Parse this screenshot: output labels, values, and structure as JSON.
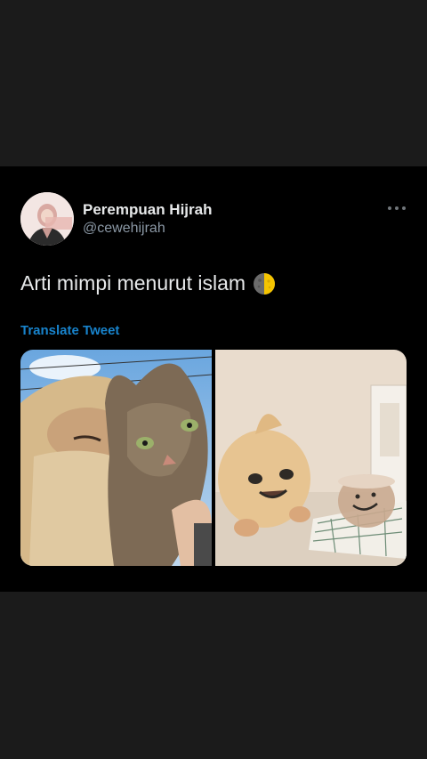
{
  "tweet": {
    "author": {
      "display_name": "Perempuan Hijrah",
      "handle": "@cewehijrah"
    },
    "text": "Arti mimpi menurut islam",
    "emoji_icon": "first-quarter-moon-icon",
    "translate_label": "Translate Tweet",
    "media": [
      {
        "description_icon": "photo-girl-with-cat"
      },
      {
        "description_icon": "photo-plush-toy-and-cup"
      }
    ]
  },
  "colors": {
    "background_outer": "#1b1b1b",
    "card_background": "#000000",
    "accent": "#1d9bf0",
    "secondary_text": "#8b98a5"
  }
}
